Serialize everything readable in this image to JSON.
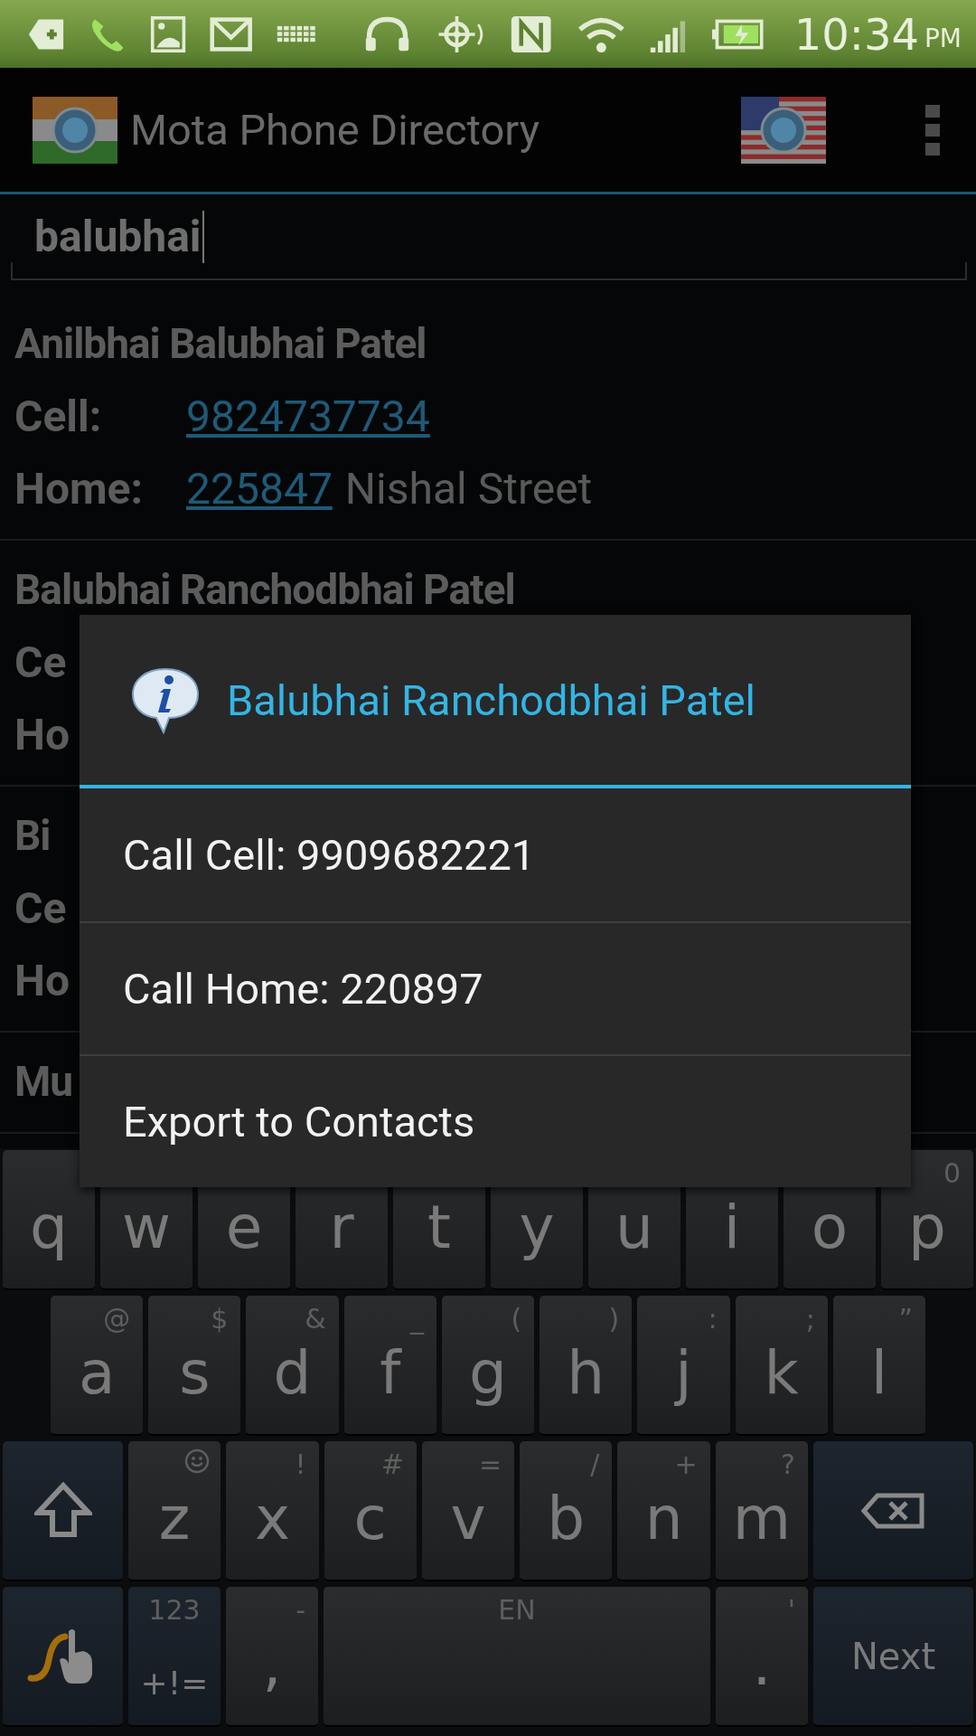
{
  "status_bar": {
    "time": "10:34",
    "meridiem": "PM"
  },
  "app_bar": {
    "title": "Mota Phone Directory"
  },
  "search": {
    "value": "balubhai"
  },
  "contacts": [
    {
      "name": "Anilbhai Balubhai Patel",
      "lines": [
        {
          "label": "Cell:",
          "number": "9824737734"
        },
        {
          "label": "Home:",
          "number": "225847",
          "address": "Nishal Street"
        }
      ]
    },
    {
      "name": "Balubhai Ranchodbhai Patel",
      "lines": [
        {
          "label": "Ce"
        },
        {
          "label": "Ho"
        }
      ]
    },
    {
      "name": "Bi",
      "lines": [
        {
          "label": "Ce"
        },
        {
          "label": "Ho"
        }
      ]
    },
    {
      "name": "Mu"
    }
  ],
  "dialog": {
    "title": "Balubhai Ranchodbhai Patel",
    "items": [
      "Call Cell: 9909682221",
      "Call Home: 220897",
      "Export to Contacts"
    ]
  },
  "keyboard": {
    "rows": [
      {
        "keys": [
          {
            "kind": "letter",
            "main": "q"
          },
          {
            "kind": "letter",
            "main": "w"
          },
          {
            "kind": "letter",
            "main": "e"
          },
          {
            "kind": "letter",
            "main": "r"
          },
          {
            "kind": "letter",
            "main": "t"
          },
          {
            "kind": "letter",
            "main": "y"
          },
          {
            "kind": "letter",
            "main": "u"
          },
          {
            "kind": "letter",
            "main": "i"
          },
          {
            "kind": "letter",
            "main": "o"
          },
          {
            "kind": "letter",
            "main": "p",
            "hint": "0"
          }
        ]
      },
      {
        "keys": [
          {
            "kind": "letter",
            "main": "a",
            "hint": "@"
          },
          {
            "kind": "letter",
            "main": "s",
            "hint": "$"
          },
          {
            "kind": "letter",
            "main": "d",
            "hint": "&"
          },
          {
            "kind": "letter",
            "main": "f",
            "hint": "_"
          },
          {
            "kind": "letter",
            "main": "g",
            "hint": "("
          },
          {
            "kind": "letter",
            "main": "h",
            "hint": ")"
          },
          {
            "kind": "letter",
            "main": "j",
            "hint": ":"
          },
          {
            "kind": "letter",
            "main": "k",
            "hint": ";"
          },
          {
            "kind": "letter",
            "main": "l",
            "hint": "”"
          }
        ]
      },
      {
        "keys": [
          {
            "kind": "shift"
          },
          {
            "kind": "emoji",
            "main": "z"
          },
          {
            "kind": "letter",
            "main": "x",
            "hint": "!"
          },
          {
            "kind": "letter",
            "main": "c",
            "hint": "#"
          },
          {
            "kind": "letter",
            "main": "v",
            "hint": "="
          },
          {
            "kind": "letter",
            "main": "b",
            "hint": "/"
          },
          {
            "kind": "letter",
            "main": "n",
            "hint": "+"
          },
          {
            "kind": "letter",
            "main": "m",
            "hint": "?"
          },
          {
            "kind": "backspace"
          }
        ]
      },
      {
        "keys": [
          {
            "kind": "swype"
          },
          {
            "kind": "symbols",
            "main": "+!=",
            "hint": "123"
          },
          {
            "kind": "letter",
            "main": ",",
            "hint": "-"
          },
          {
            "kind": "space",
            "hint": "EN"
          },
          {
            "kind": "letter",
            "main": ".",
            "hint": "'"
          },
          {
            "kind": "action",
            "main": "Next"
          }
        ]
      }
    ]
  }
}
